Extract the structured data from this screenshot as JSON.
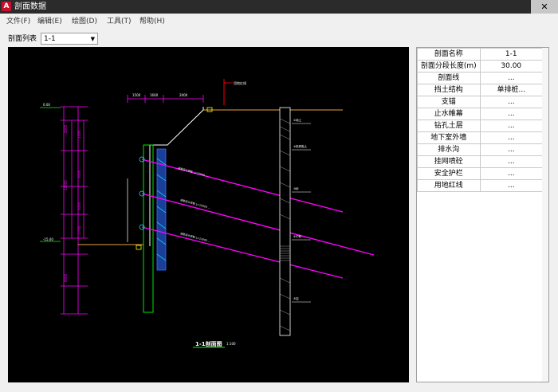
{
  "window": {
    "title": "剖面数据",
    "close_glyph": "✕",
    "app_icon_glyph": "A"
  },
  "menu": [
    "文件(F)",
    "编辑(E)",
    "绘图(D)",
    "工具(T)",
    "帮助(H)"
  ],
  "toolbar": {
    "section_list_label": "剖面列表",
    "section_selected": "1-1"
  },
  "properties": [
    {
      "name": "剖面名称",
      "value": "1-1"
    },
    {
      "name": "剖面分段长度(m)",
      "value": "30.00"
    },
    {
      "name": "剖面线",
      "value": "..."
    },
    {
      "name": "挡土结构",
      "value": "单排桩..."
    },
    {
      "name": "支锚",
      "value": "..."
    },
    {
      "name": "止水帷幕",
      "value": "..."
    },
    {
      "name": "钻孔土层",
      "value": "..."
    },
    {
      "name": "地下室外墙",
      "value": "..."
    },
    {
      "name": "排水沟",
      "value": "..."
    },
    {
      "name": "挂网喷砼",
      "value": "..."
    },
    {
      "name": "安全护栏",
      "value": "..."
    },
    {
      "name": "用地红线",
      "value": "..."
    }
  ],
  "drawing": {
    "section_title": "1-1剖面图",
    "scale": "1:100",
    "colors": {
      "background": "#000000",
      "ground": "#e8a040",
      "anchor": "#ff00ff",
      "dimension": "#ff00ff",
      "wall": "#00ff00",
      "pile": "#3070ff",
      "borehole": "#ffffff",
      "marker": "#ff0000"
    }
  }
}
